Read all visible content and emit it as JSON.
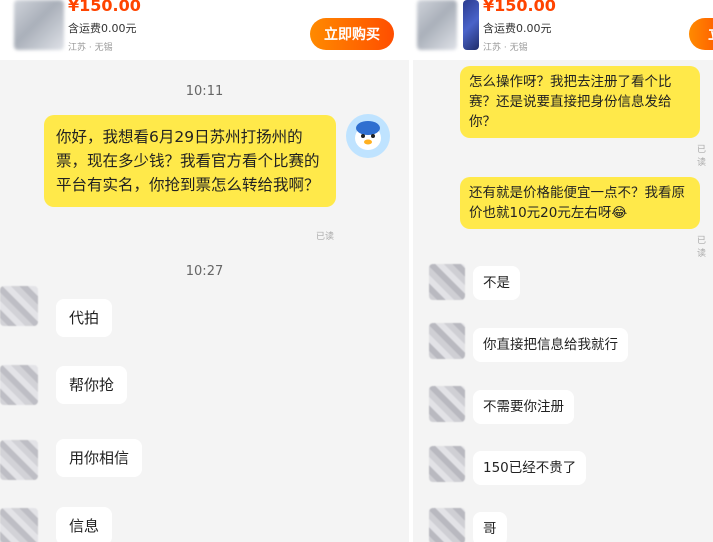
{
  "left": {
    "product": {
      "price": "¥150.00",
      "shipping": "含运费0.00元",
      "location": "江苏 · 无锡",
      "buy_button": "立即购买"
    },
    "timestamp_1": "10:11",
    "outgoing_message": "你好，我想看6月29日苏州打扬州的票，现在多少钱？我看官方看个比赛的平台有实名，你抢到票怎么转给我啊？",
    "read_status": "已读",
    "timestamp_2": "10:27",
    "incoming": [
      "代拍",
      "帮你抢",
      "用你相信",
      "信息"
    ]
  },
  "right": {
    "product": {
      "price": "¥150.00",
      "shipping": "含运费0.00元",
      "location": "江苏 · 无锡",
      "buy_button": "立"
    },
    "outgoing_1": "怎么操作呀？我把去注册了看个比赛？还是说要直接把身份信息发给你？",
    "read_1": "已读",
    "outgoing_2": "还有就是价格能便宜一点不？我看原价也就10元20元左右呀😂",
    "read_2": "已读",
    "incoming": [
      "不是",
      "你直接把信息给我就行",
      "不需要你注册",
      "150已经不贵了",
      "哥"
    ]
  },
  "icons": {
    "own_avatar": "penguin-avatar-icon",
    "contact_avatar": "pixelated-avatar"
  },
  "colors": {
    "price": "#ff4400",
    "buy_button": "#ff5a00",
    "outgoing_bubble": "#ffe94a",
    "chat_bg": "#f4f4f4"
  }
}
